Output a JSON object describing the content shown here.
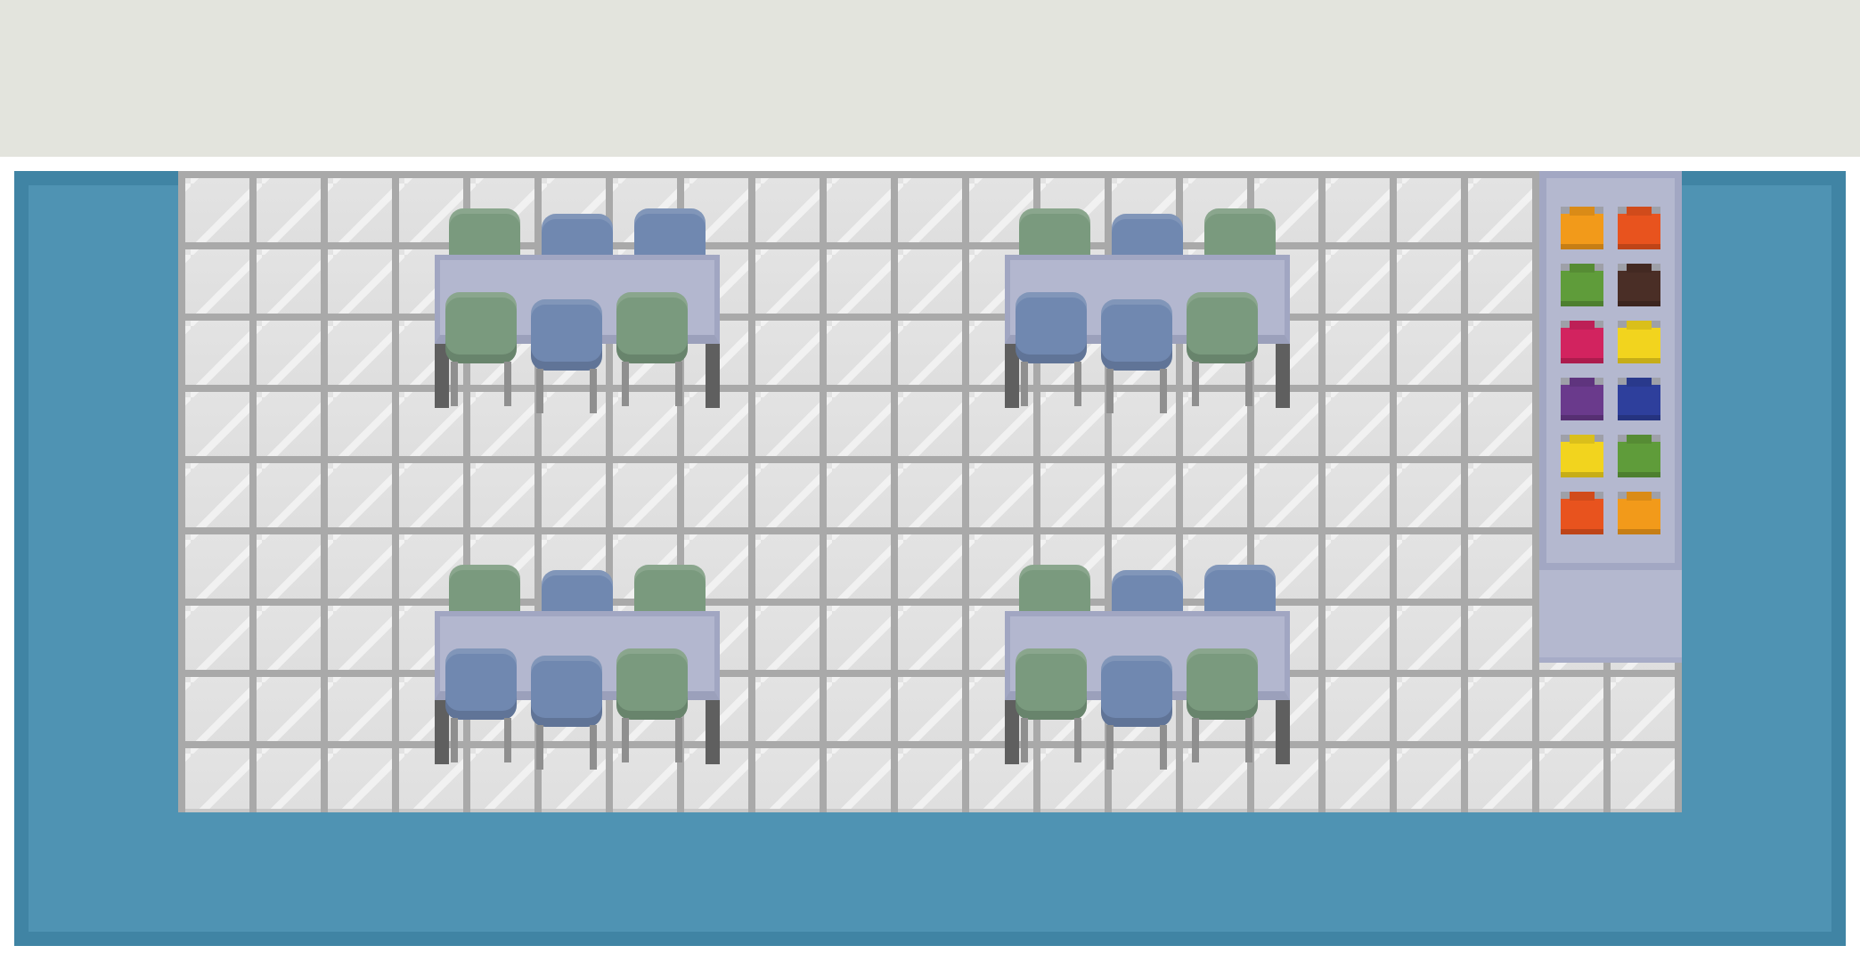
{
  "colors": {
    "water": "#4f93b3",
    "floor": "#e0e0e0",
    "desk": "#b3b7cf",
    "chair_green": "#7a9a7e",
    "chair_blue": "#7088b0"
  },
  "desks": [
    {
      "back_chairs": [
        "green",
        "blue",
        "blue"
      ],
      "front_chairs": [
        "green",
        "blue",
        "green"
      ]
    },
    {
      "back_chairs": [
        "green",
        "blue",
        "green"
      ],
      "front_chairs": [
        "blue",
        "blue",
        "green"
      ]
    },
    {
      "back_chairs": [
        "green",
        "blue",
        "green"
      ],
      "front_chairs": [
        "blue",
        "blue",
        "green"
      ]
    },
    {
      "back_chairs": [
        "green",
        "blue",
        "blue"
      ],
      "front_chairs": [
        "green",
        "blue",
        "green"
      ]
    }
  ],
  "shelf_bins": [
    "#f29a1a",
    "#e8531e",
    "#5f9c3a",
    "#4a2e26",
    "#d2235f",
    "#f2d41e",
    "#6a3a8c",
    "#2e3f9c",
    "#f2d41e",
    "#5f9c3a",
    "#e8531e",
    "#f29a1a"
  ]
}
